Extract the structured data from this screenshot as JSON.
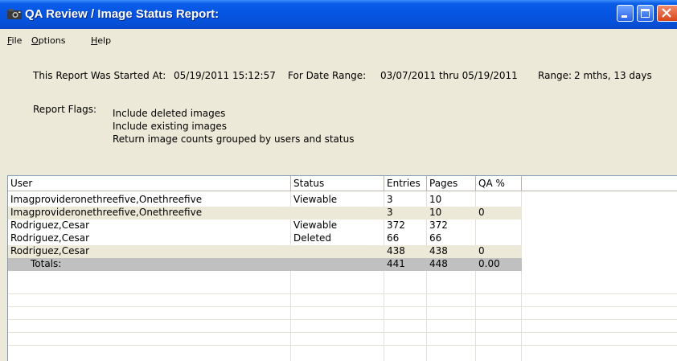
{
  "window": {
    "title": "QA Review / Image Status Report:"
  },
  "menu": [
    {
      "label": "File",
      "key": "F",
      "rest": "ile"
    },
    {
      "label": "Options",
      "key": "O",
      "rest": "ptions"
    },
    {
      "label": "Help",
      "key": "H",
      "rest": "elp"
    }
  ],
  "report": {
    "started_label": "This Report Was Started At:",
    "started_value": "05/19/2011  15:12:57",
    "range_label": "For Date Range:",
    "range_value": "03/07/2011  thru  05/19/2011",
    "span_label": "Range:",
    "span_value": "2 mths, 13 days",
    "flags_label": "Report Flags:",
    "flags": [
      "Include deleted images",
      "Include existing images",
      "Return image counts grouped by users and status"
    ]
  },
  "table": {
    "columns": [
      "User",
      "Status",
      "Entries",
      "Pages",
      "QA %"
    ],
    "rows": [
      {
        "user": "Imagprovideronethreefive,Onethreefive",
        "status": "Viewable",
        "entries": "3",
        "pages": "10",
        "qa": "",
        "type": "normal"
      },
      {
        "user": "Imagprovideronethreefive,Onethreefive",
        "status": "",
        "entries": "3",
        "pages": "10",
        "qa": "0",
        "type": "subtotal"
      },
      {
        "user": "Rodriguez,Cesar",
        "status": "Viewable",
        "entries": "372",
        "pages": "372",
        "qa": "",
        "type": "normal"
      },
      {
        "user": "Rodriguez,Cesar",
        "status": "Deleted",
        "entries": "66",
        "pages": "66",
        "qa": "",
        "type": "normal"
      },
      {
        "user": "Rodriguez,Cesar",
        "status": "",
        "entries": "438",
        "pages": "438",
        "qa": "0",
        "type": "subtotal"
      },
      {
        "user": "Totals:",
        "status": "",
        "entries": "441",
        "pages": "448",
        "qa": "0.00",
        "type": "total"
      }
    ]
  },
  "colors": {
    "titlebar": "#0554e3",
    "subtotal_row": "#ece9d8",
    "total_row": "#c0c0c0"
  }
}
